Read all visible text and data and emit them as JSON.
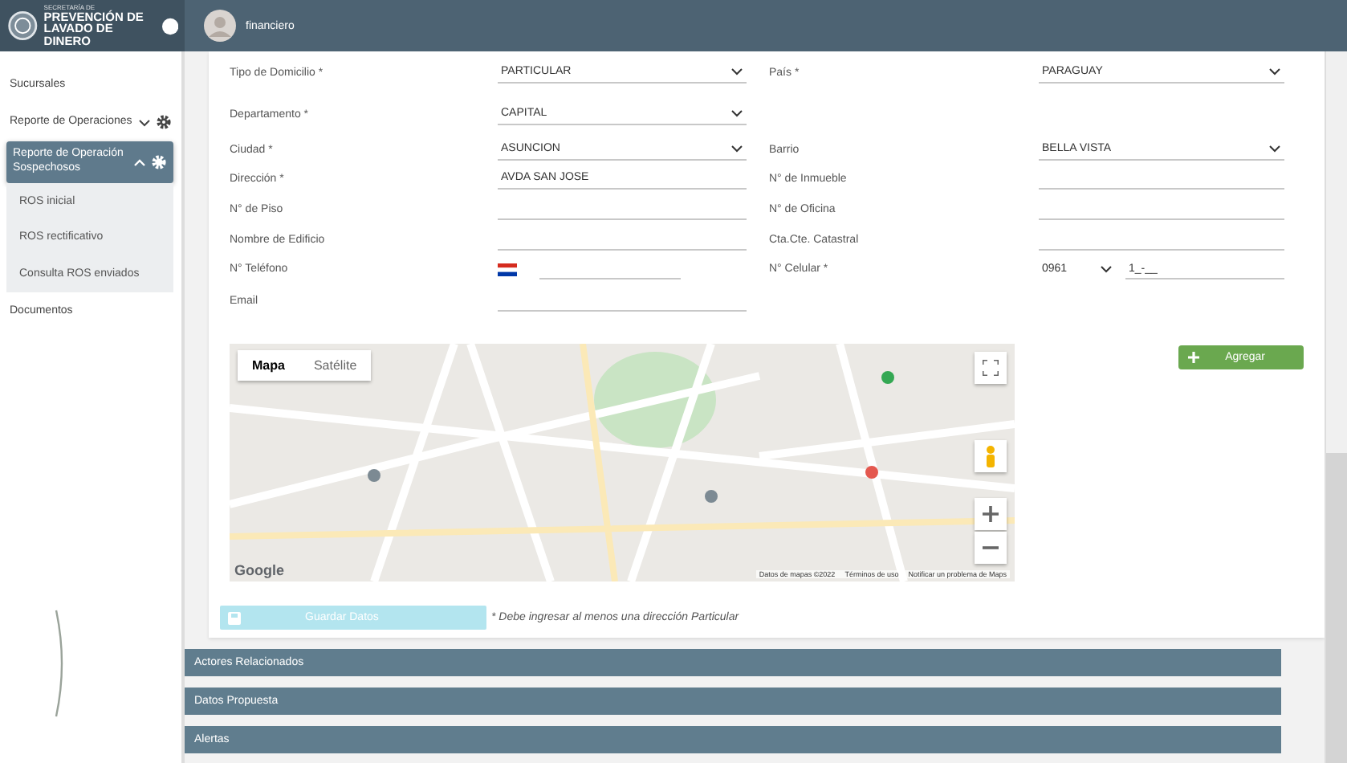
{
  "header": {
    "logo_caption": "SECRETARÍA DE",
    "logo_title_1": "PREVENCIÓN DE",
    "logo_title_2": "LAVADO DE DINERO",
    "user": "financiero"
  },
  "sidebar": {
    "items": [
      {
        "label": "Sucursales",
        "kind": "link",
        "selected": false
      },
      {
        "label": "Reporte de Operaciones",
        "kind": "group",
        "selected": false,
        "expanded": false
      },
      {
        "label": "Reporte de Operación Sospechosos",
        "kind": "group",
        "selected": true,
        "expanded": true,
        "children": [
          {
            "label": "ROS inicial",
            "selected": false
          },
          {
            "label": "ROS rectificativo",
            "selected": false
          },
          {
            "label": "Consulta ROS enviados",
            "selected": false
          }
        ]
      },
      {
        "label": "Documentos",
        "kind": "link",
        "selected": false
      }
    ]
  },
  "form": {
    "rows": [
      {
        "left": {
          "label": "Tipo de Domicilio *",
          "kind": "select",
          "value": "PARTICULAR"
        },
        "right": {
          "label": "País *",
          "kind": "select",
          "value": "PARAGUAY"
        }
      },
      {
        "left": {
          "label": "Departamento *",
          "kind": "select",
          "value": "CAPITAL"
        }
      },
      {
        "left": {
          "label": "Ciudad *",
          "kind": "select",
          "value": "ASUNCION"
        },
        "right": {
          "label": "Barrio",
          "kind": "select",
          "value": "BELLA VISTA"
        }
      },
      {
        "left": {
          "label": "Dirección *",
          "kind": "text",
          "value": "AVDA SAN JOSE"
        },
        "right": {
          "label": "N° de Inmueble",
          "kind": "text"
        }
      },
      {
        "left": {
          "label": "N° de Piso",
          "kind": "text"
        },
        "right": {
          "label": "N° de Oficina",
          "kind": "text"
        }
      },
      {
        "left": {
          "label": "Nombre de Edificio",
          "kind": "text"
        },
        "right": {
          "label": "Cta.Cte. Catastral",
          "kind": "text"
        }
      },
      {
        "left": {
          "label": "N° Teléfono",
          "kind": "phone"
        },
        "right": {
          "label": "N° Celular *",
          "kind": "cellular",
          "prefix": "0961",
          "value": "1_-__"
        }
      },
      {
        "left": {
          "label": "Email",
          "kind": "text"
        }
      }
    ]
  },
  "map": {
    "tabs": [
      {
        "label": "Mapa",
        "selected": true
      },
      {
        "label": "Satélite",
        "selected": false
      }
    ],
    "logo": "Google",
    "attribution": [
      "Datos de mapas ©2022",
      "Términos de uso",
      "Notificar un problema de Maps"
    ]
  },
  "add_button": {
    "label": "Agregar"
  },
  "save_button": {
    "label": "Guardar Datos",
    "disabled": true
  },
  "save_note": "* Debe ingresar al menos una dirección Particular",
  "sections": [
    {
      "title": "Actores Relacionados"
    },
    {
      "title": "Datos Propuesta"
    },
    {
      "title": "Alertas"
    }
  ]
}
